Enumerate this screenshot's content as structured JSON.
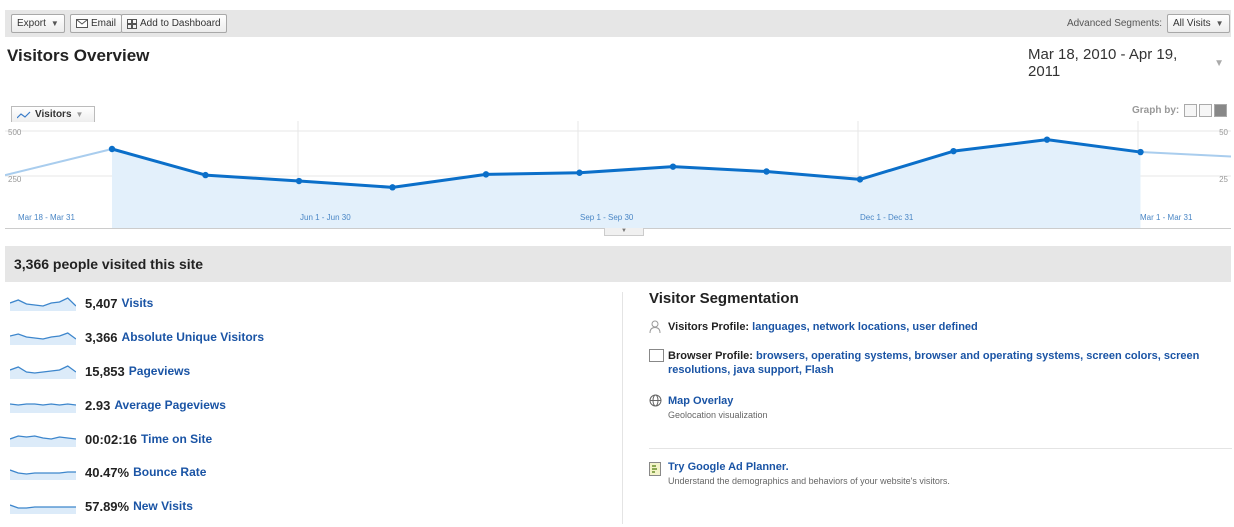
{
  "toolbar": {
    "export_label": "Export",
    "email_label": "Email",
    "dashboard_label": "Add to Dashboard",
    "segments_label": "Advanced Segments:",
    "segments_value": "All Visits"
  },
  "page_title": "Visitors Overview",
  "date_range": "Mar 18, 2010 - Apr 19, 2011",
  "graph": {
    "metric_tab": "Visitors",
    "graph_by_label": "Graph by:",
    "y_tick_top": "500",
    "y_tick_mid": "250",
    "y_tick_top_right": "50",
    "y_tick_mid_right": "25",
    "x_labels": [
      "Mar 18 - Mar 31",
      "Jun 1 - Jun 30",
      "Sep 1 - Sep 30",
      "Dec 1 - Dec 31",
      "Mar 1 - Mar 31"
    ]
  },
  "chart_data": {
    "type": "line",
    "series": [
      {
        "name": "Visitors",
        "values": [
          255,
          400,
          255,
          222,
          187,
          259,
          268,
          302,
          275,
          231,
          388,
          452,
          383,
          358
        ]
      }
    ],
    "partial_first": true,
    "partial_last": true,
    "ylim": [
      0,
      500
    ],
    "yticks": [
      "500",
      "250"
    ],
    "xlabels": [
      "Mar 18 - Mar 31",
      "Jun 1 - Jun 30",
      "Sep 1 - Sep 30",
      "Dec 1 - Dec 31",
      "Mar 1 - Mar 31"
    ],
    "line_color": "#0b6fc9",
    "fill_color": "#e3f0fb"
  },
  "summary": "3,366 people visited this site",
  "metrics": [
    {
      "value": "5,407",
      "label": "Visits",
      "spark": [
        8,
        11,
        7,
        6,
        5,
        8,
        9,
        13,
        5
      ]
    },
    {
      "value": "3,366",
      "label": "Absolute Unique Visitors",
      "spark": [
        9,
        11,
        8,
        7,
        6,
        8,
        9,
        12,
        6
      ]
    },
    {
      "value": "15,853",
      "label": "Pageviews",
      "spark": [
        9,
        12,
        7,
        6,
        7,
        8,
        9,
        13,
        7
      ]
    },
    {
      "value": "2.93",
      "label": "Average Pageviews",
      "spark": [
        9,
        8,
        9,
        9,
        8,
        9,
        8,
        9,
        8
      ]
    },
    {
      "value": "00:02:16",
      "label": "Time on Site",
      "spark": [
        8,
        11,
        10,
        11,
        9,
        8,
        10,
        9,
        8
      ]
    },
    {
      "value": "40.47%",
      "label": "Bounce Rate",
      "spark": [
        10,
        7,
        6,
        7,
        7,
        7,
        7,
        8,
        8
      ]
    },
    {
      "value": "57.89%",
      "label": "New Visits",
      "spark": [
        9,
        6,
        6,
        7,
        7,
        7,
        7,
        7,
        7
      ]
    }
  ],
  "segmentation": {
    "title": "Visitor Segmentation",
    "visitors_profile": {
      "label": "Visitors Profile:",
      "links": [
        "languages",
        "network locations",
        "user defined"
      ]
    },
    "browser_profile": {
      "label": "Browser Profile:",
      "links": [
        "browsers",
        "operating systems",
        "browser and operating systems",
        "screen colors",
        "screen resolutions",
        "java support",
        "Flash"
      ]
    },
    "map_overlay": {
      "title": "Map Overlay",
      "subtitle": "Geolocation visualization"
    },
    "ad_planner": {
      "title": "Try Google Ad Planner.",
      "subtitle": "Understand the demographics and behaviors of your website's visitors."
    }
  },
  "colors": {
    "link": "#1a54a5",
    "line": "#0b6fc9",
    "fill": "#e3f0fb",
    "bar_bg": "#e6e6e6"
  }
}
